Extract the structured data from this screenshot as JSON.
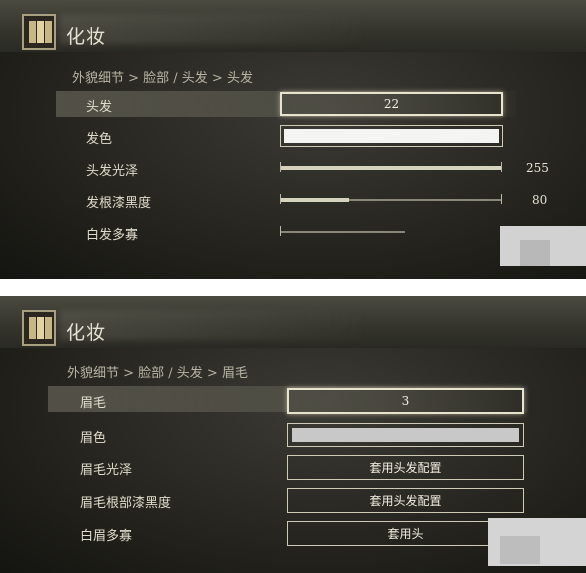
{
  "panel1": {
    "title": "化妆",
    "breadcrumb": "外貌细节 > 脸部 / 头发 > 头发",
    "rows": [
      {
        "label": "头发",
        "value": "22"
      },
      {
        "label": "发色"
      },
      {
        "label": "头发光泽",
        "value": "255",
        "level": 1.0
      },
      {
        "label": "发根漆黑度",
        "value": "80",
        "level": 0.31
      },
      {
        "label": "白发多寡",
        "level": 0.0
      }
    ]
  },
  "panel2": {
    "title": "化妆",
    "breadcrumb": "外貌细节 > 脸部 / 头发 > 眉毛",
    "rows": [
      {
        "label": "眉毛",
        "value": "3"
      },
      {
        "label": "眉色"
      },
      {
        "label": "眉毛光泽",
        "value": "套用头发配置"
      },
      {
        "label": "眉毛根部漆黑度",
        "value": "套用头发配置"
      },
      {
        "label": "白眉多寡",
        "value": "套用头"
      }
    ]
  },
  "colors": {
    "panel_bg": "#26251f",
    "text": "#e0dccb",
    "swatch_white": "#f4f4f2",
    "swatch_grey": "#c8c8c8"
  }
}
